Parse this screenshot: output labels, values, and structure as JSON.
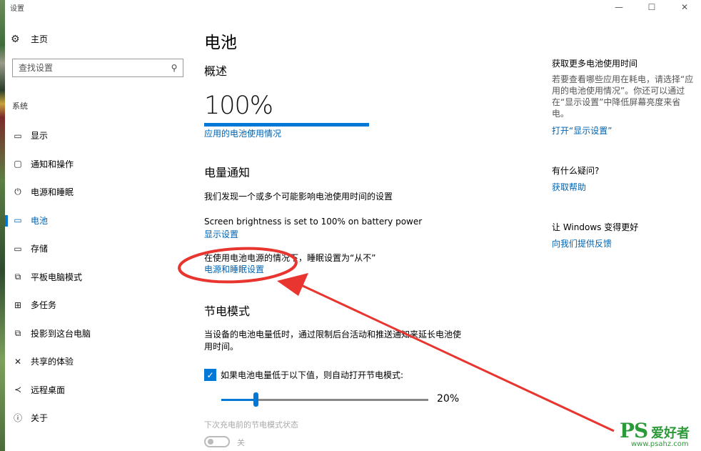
{
  "window": {
    "title": "设置",
    "controls": [
      "—",
      "☐",
      "✕"
    ]
  },
  "sidebar": {
    "home_label": "主页",
    "search_placeholder": "查找设置",
    "section": "系统",
    "items": [
      {
        "label": "显示",
        "icon": "monitor-icon",
        "glyph": "▭"
      },
      {
        "label": "通知和操作",
        "icon": "notification-icon",
        "glyph": "▢"
      },
      {
        "label": "电源和睡眠",
        "icon": "power-icon",
        "glyph": "⏻"
      },
      {
        "label": "电池",
        "icon": "battery-icon",
        "glyph": "▭",
        "active": true
      },
      {
        "label": "存储",
        "icon": "storage-icon",
        "glyph": "▭"
      },
      {
        "label": "平板电脑模式",
        "icon": "tablet-icon",
        "glyph": "⧉"
      },
      {
        "label": "多任务",
        "icon": "multitask-icon",
        "glyph": "⊞"
      },
      {
        "label": "投影到这台电脑",
        "icon": "project-icon",
        "glyph": "⧉"
      },
      {
        "label": "共享的体验",
        "icon": "share-icon",
        "glyph": "✕"
      },
      {
        "label": "远程桌面",
        "icon": "remote-icon",
        "glyph": "≺"
      },
      {
        "label": "关于",
        "icon": "info-icon",
        "glyph": "ⓘ"
      }
    ]
  },
  "main": {
    "title": "电池",
    "overview_heading": "概述",
    "battery_percent_text": "100%",
    "battery_level": 1.0,
    "battery_usage_link": "应用的电池使用情况",
    "notify_heading": "电量通知",
    "notify_desc": "我们发现一个或多个可能影响电池使用时间的设置",
    "brightness_text": "Screen brightness is set to 100% on battery power",
    "display_settings_link": "显示设置",
    "sleep_text": "在使用电池电源的情况下，睡眠设置为“从不”",
    "power_sleep_link": "电源和睡眠设置",
    "saver_heading": "节电模式",
    "saver_desc": "当设备的电池电量低时，通过限制后台活动和推送通知来延长电池使用时间。",
    "saver_checkbox_label": "如果电池电量低于以下值，则自动打开节电模式:",
    "saver_checked": true,
    "saver_threshold_text": "20%",
    "saver_threshold": 0.2,
    "saver_status_label": "下次充电前的节电模式状态",
    "saver_toggle_label": "关"
  },
  "right": {
    "more_heading": "获取更多电池使用时间",
    "more_desc": "若要查看哪些应用在耗电，请选择“应用的电池使用情况”。你还可以通过在“显示设置”中降低屏幕亮度来省电。",
    "open_display_link": "打开“显示设置”",
    "question_heading": "有什么疑问?",
    "help_link": "获取帮助",
    "improve_heading": "让 Windows 变得更好",
    "feedback_link": "向我们提供反馈"
  },
  "watermark": {
    "ps": "PS",
    "cn": "爱好者",
    "url": "www.psahz.com"
  },
  "colors": {
    "accent": "#0078d7",
    "link": "#0063b1",
    "annotation": "#e8352f",
    "watermark": "#2d9a3a"
  }
}
